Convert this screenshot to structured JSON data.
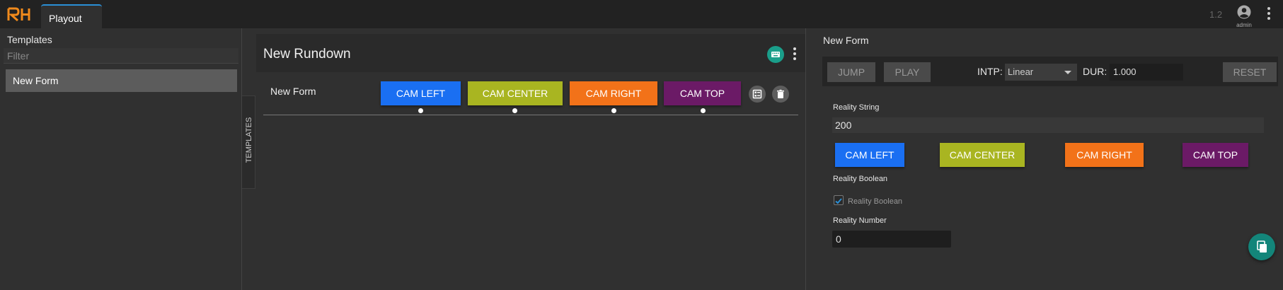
{
  "app": {
    "logo_text": "RH",
    "tab_label": "Playout",
    "version": "1.2",
    "user_name": "admin",
    "accent": "#2a8fd6"
  },
  "templates_panel": {
    "title": "Templates",
    "filter_placeholder": "Filter",
    "items": [
      {
        "label": "New Form"
      }
    ],
    "side_tab_label": "TEMPLATES"
  },
  "rundown": {
    "title": "New Rundown",
    "icons": [
      "keyboard-icon",
      "more-vert-icon"
    ],
    "rows": [
      {
        "name": "New Form",
        "buttons": [
          {
            "label": "CAM LEFT",
            "color": "#1a6ff2"
          },
          {
            "label": "CAM CENTER",
            "color": "#a9b521"
          },
          {
            "label": "CAM RIGHT",
            "color": "#f27219"
          },
          {
            "label": "CAM TOP",
            "color": "#6b1a66"
          }
        ],
        "actions": [
          "edit-form-icon",
          "delete-icon"
        ]
      }
    ]
  },
  "right_panel": {
    "title": "New Form",
    "controls": {
      "jump_label": "JUMP",
      "play_label": "PLAY",
      "intp_label": "INTP:",
      "intp_value": "Linear",
      "dur_label": "DUR:",
      "dur_value": "1.000",
      "reset_label": "RESET"
    },
    "reality_string": {
      "label": "Reality String",
      "value": "200"
    },
    "cam_buttons": [
      {
        "label": "CAM LEFT",
        "color": "#1a6ff2"
      },
      {
        "label": "CAM CENTER",
        "color": "#a9b521"
      },
      {
        "label": "CAM RIGHT",
        "color": "#f27219"
      },
      {
        "label": "CAM TOP",
        "color": "#6b1a66"
      }
    ],
    "reality_boolean": {
      "label": "Reality Boolean",
      "checkbox_label": "Reality Boolean",
      "checked": true
    },
    "reality_number": {
      "label": "Reality Number",
      "value": "0"
    },
    "fab_icon": "copy-icon"
  }
}
